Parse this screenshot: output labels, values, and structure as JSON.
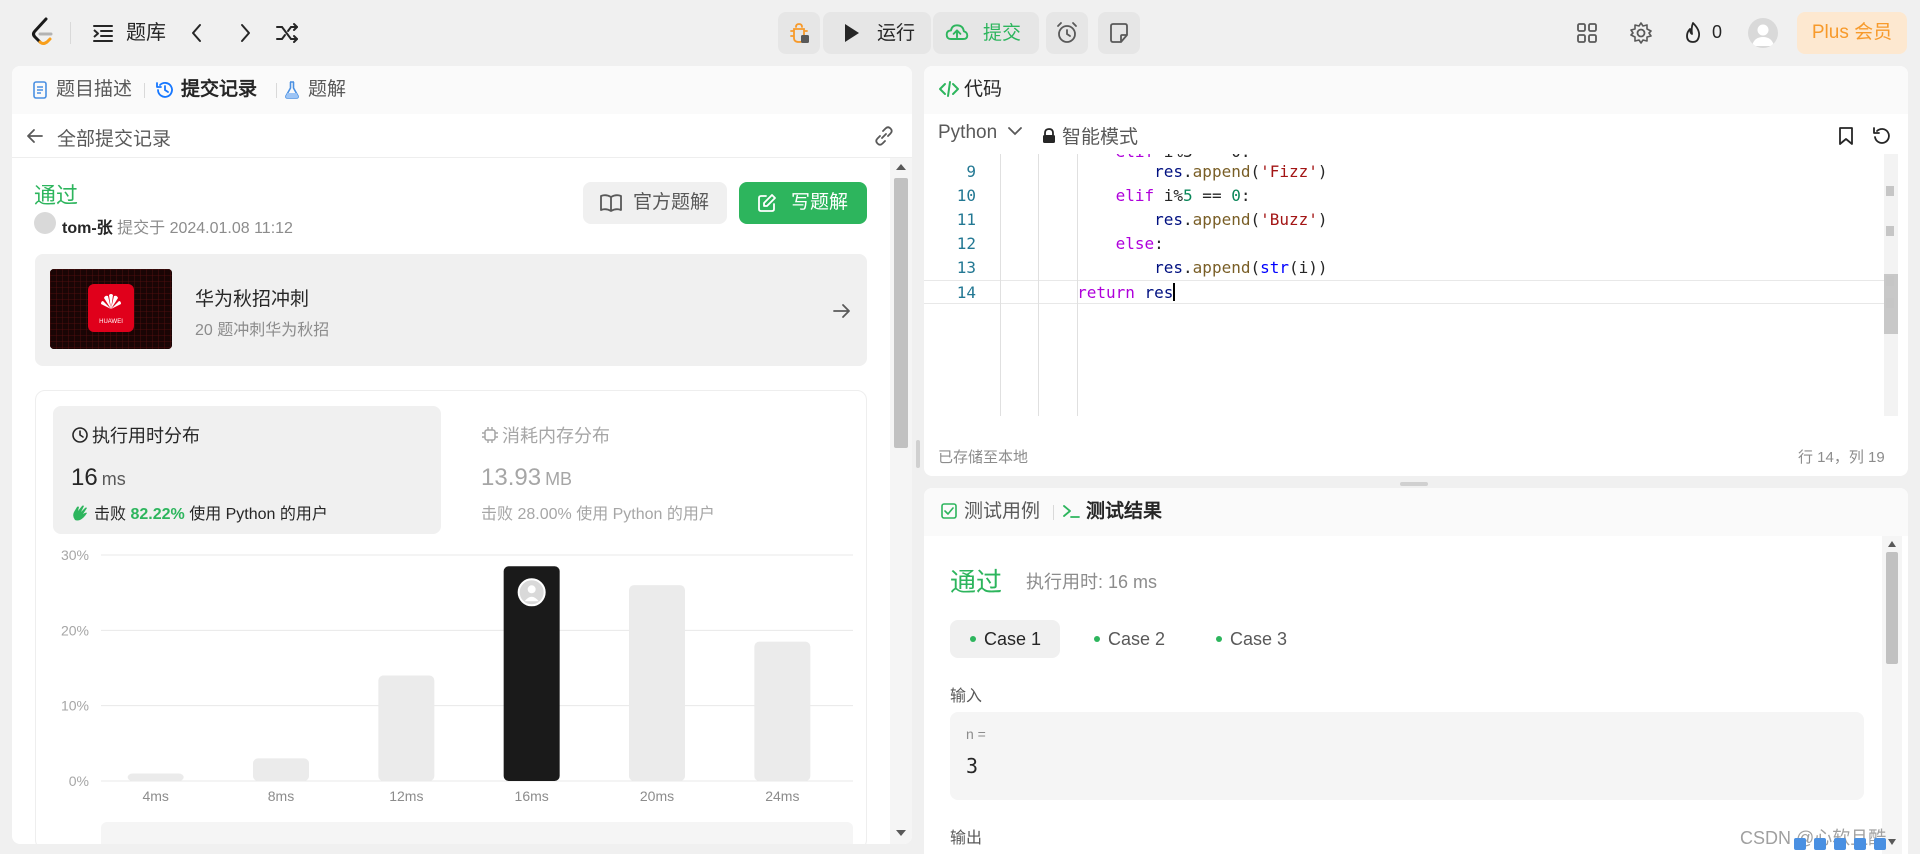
{
  "topbar": {
    "problem_list_label": "题库",
    "run_label": "运行",
    "submit_label": "提交",
    "fire_count": "0",
    "plus_label": "Plus 会员"
  },
  "left": {
    "tabs": [
      {
        "label": "题目描述"
      },
      {
        "label": "提交记录"
      },
      {
        "label": "题解"
      }
    ],
    "subheader": "全部提交记录",
    "status": "通过",
    "author": "tom-张",
    "submitted_at": "提交于 2024.01.08 11:12",
    "official_solution_label": "官方题解",
    "write_solution_label": "写题解",
    "promo": {
      "title": "华为秋招冲刺",
      "subtitle": "20 题冲刺华为秋招",
      "image_label": "HUAWEI"
    },
    "runtime": {
      "title": "执行用时分布",
      "value": "16",
      "unit": "ms",
      "beat_prefix": "击败",
      "beat_pct": "82.22%",
      "beat_suffix": "使用 Python 的用户"
    },
    "memory": {
      "title": "消耗内存分布",
      "value": "13.93",
      "unit": "MB",
      "beat_prefix": "击败",
      "beat_pct": "28.00%",
      "beat_suffix": "使用 Python 的用户"
    }
  },
  "chart_data": {
    "type": "bar",
    "title": "",
    "xlabel": "",
    "ylabel": "",
    "categories": [
      "4ms",
      "8ms",
      "12ms",
      "16ms",
      "20ms",
      "24ms"
    ],
    "values": [
      1,
      3,
      14,
      28.5,
      26,
      18.5
    ],
    "highlight_category": "16ms",
    "ylim": [
      0,
      30
    ],
    "yticks": [
      "0%",
      "10%",
      "20%",
      "30%"
    ],
    "colors": {
      "bar": "#ebebeb",
      "highlight": "#1a1a1a",
      "grid": "#e8e8e8"
    },
    "grid": true
  },
  "editor": {
    "title": "代码",
    "language": "Python",
    "mode": "智能模式",
    "lines": [
      {
        "n": "9",
        "indent": 4
      },
      {
        "n": "10",
        "indent": 3
      },
      {
        "n": "11",
        "indent": 4
      },
      {
        "n": "12",
        "indent": 3
      },
      {
        "n": "13",
        "indent": 4
      },
      {
        "n": "14",
        "indent": 2
      }
    ],
    "saved_status": "已存储至本地",
    "cursor_position": "行 14，列 19"
  },
  "tests": {
    "tab_cases": "测试用例",
    "tab_result": "测试结果",
    "status": "通过",
    "runtime": "执行用时: 16 ms",
    "cases": [
      "Case 1",
      "Case 2",
      "Case 3"
    ],
    "input_label": "输入",
    "input_name": "n =",
    "input_value": "3",
    "output_label": "输出"
  },
  "watermark": "CSDN @心软且酷"
}
